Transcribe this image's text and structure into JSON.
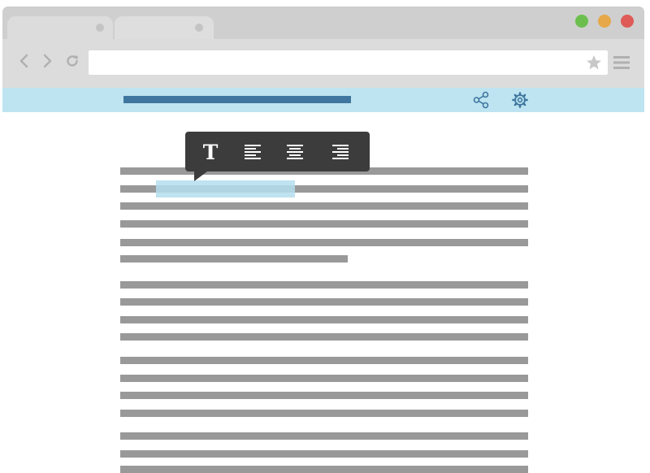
{
  "browser": {
    "tabs": [
      {
        "label": "",
        "active": true
      },
      {
        "label": "",
        "active": false
      }
    ],
    "window_controls": [
      "minimize-green",
      "zoom-yellow",
      "close-red"
    ],
    "address_bar": {
      "value": "",
      "placeholder": ""
    },
    "toolbar_icons": [
      "back-icon",
      "forward-icon",
      "reload-icon",
      "bookmark-star-icon",
      "menu-icon"
    ]
  },
  "extension_bar": {
    "progress": 1.0,
    "icons": [
      "share-icon",
      "gear-icon"
    ]
  },
  "format_popup": {
    "text_style_glyph": "T",
    "buttons": [
      "text-style-icon",
      "align-left-icon",
      "align-center-icon",
      "align-right-icon"
    ]
  },
  "colors": {
    "chrome": "#dcdcdc",
    "extension_bar": "#bde4f0",
    "accent": "#3f76a0",
    "text_placeholder": "#999999",
    "selection": "#b4deee",
    "popup": "#3c3c3c"
  }
}
